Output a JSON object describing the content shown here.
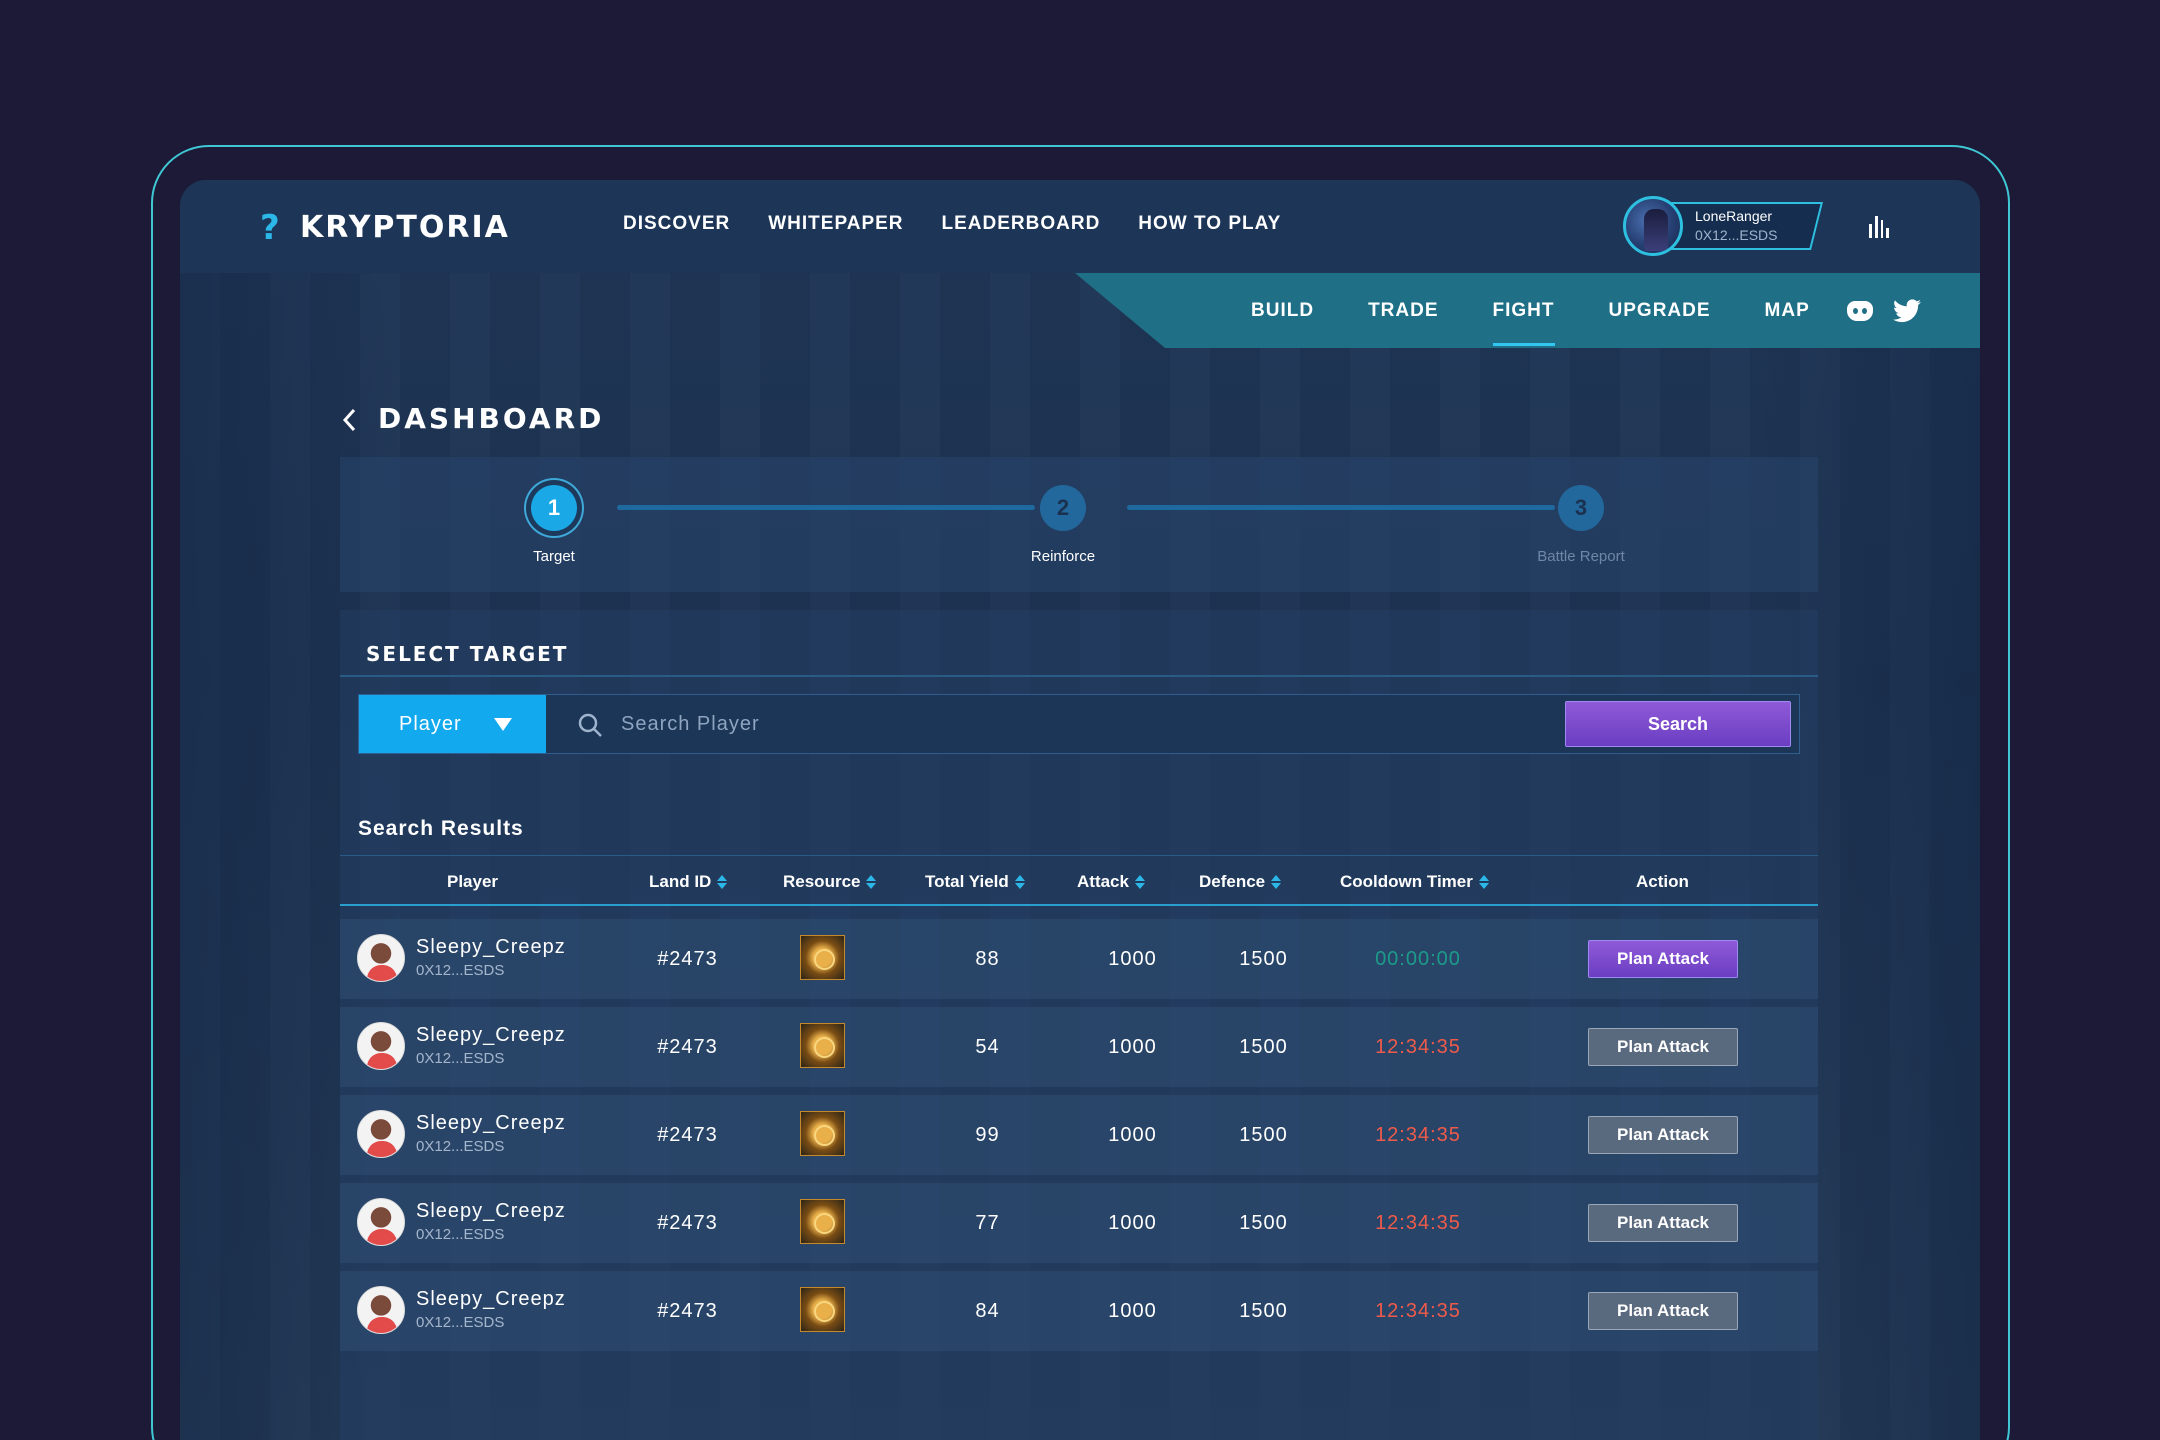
{
  "brand": {
    "name": "KRYPTORIA",
    "accent": "#2bb8e8"
  },
  "main_nav": [
    "DISCOVER",
    "WHITEPAPER",
    "LEADERBOARD",
    "HOW TO PLAY"
  ],
  "user": {
    "name": "LoneRanger",
    "address": "0X12...ESDS"
  },
  "sub_nav": {
    "items": [
      "BUILD",
      "TRADE",
      "FIGHT",
      "UPGRADE",
      "MAP"
    ],
    "active": "FIGHT"
  },
  "page": {
    "title": "DASHBOARD"
  },
  "stepper": {
    "steps": [
      {
        "number": "1",
        "label": "Target",
        "state": "active"
      },
      {
        "number": "2",
        "label": "Reinforce",
        "state": "pending"
      },
      {
        "number": "3",
        "label": "Battle Report",
        "state": "disabled"
      }
    ]
  },
  "select_target": {
    "title": "SELECT TARGET",
    "type_value": "Player",
    "search_placeholder": "Search Player",
    "search_button": "Search"
  },
  "results": {
    "title": "Search Results",
    "columns": [
      "Player",
      "Land ID",
      "Resource",
      "Total Yield",
      "Attack",
      "Defence",
      "Cooldown Timer",
      "Action"
    ],
    "rows": [
      {
        "player": "Sleepy_Creepz",
        "address": "0X12...ESDS",
        "land_id": "#2473",
        "total_yield": "88",
        "attack": "1000",
        "defence": "1500",
        "cooldown": "00:00:00",
        "action": "Plan Attack"
      },
      {
        "player": "Sleepy_Creepz",
        "address": "0X12...ESDS",
        "land_id": "#2473",
        "total_yield": "54",
        "attack": "1000",
        "defence": "1500",
        "cooldown": "12:34:35",
        "action": "Plan Attack"
      },
      {
        "player": "Sleepy_Creepz",
        "address": "0X12...ESDS",
        "land_id": "#2473",
        "total_yield": "99",
        "attack": "1000",
        "defence": "1500",
        "cooldown": "12:34:35",
        "action": "Plan Attack"
      },
      {
        "player": "Sleepy_Creepz",
        "address": "0X12...ESDS",
        "land_id": "#2473",
        "total_yield": "77",
        "attack": "1000",
        "defence": "1500",
        "cooldown": "12:34:35",
        "action": "Plan Attack"
      },
      {
        "player": "Sleepy_Creepz",
        "address": "0X12...ESDS",
        "land_id": "#2473",
        "total_yield": "84",
        "attack": "1000",
        "defence": "1500",
        "cooldown": "12:34:35",
        "action": "Plan Attack"
      }
    ]
  },
  "colors": {
    "frame": "#3fc7d4",
    "primary_button": "#7a4ccc",
    "timer_ready": "#1d9b8a",
    "timer_cooldown": "#ef5a4a"
  }
}
